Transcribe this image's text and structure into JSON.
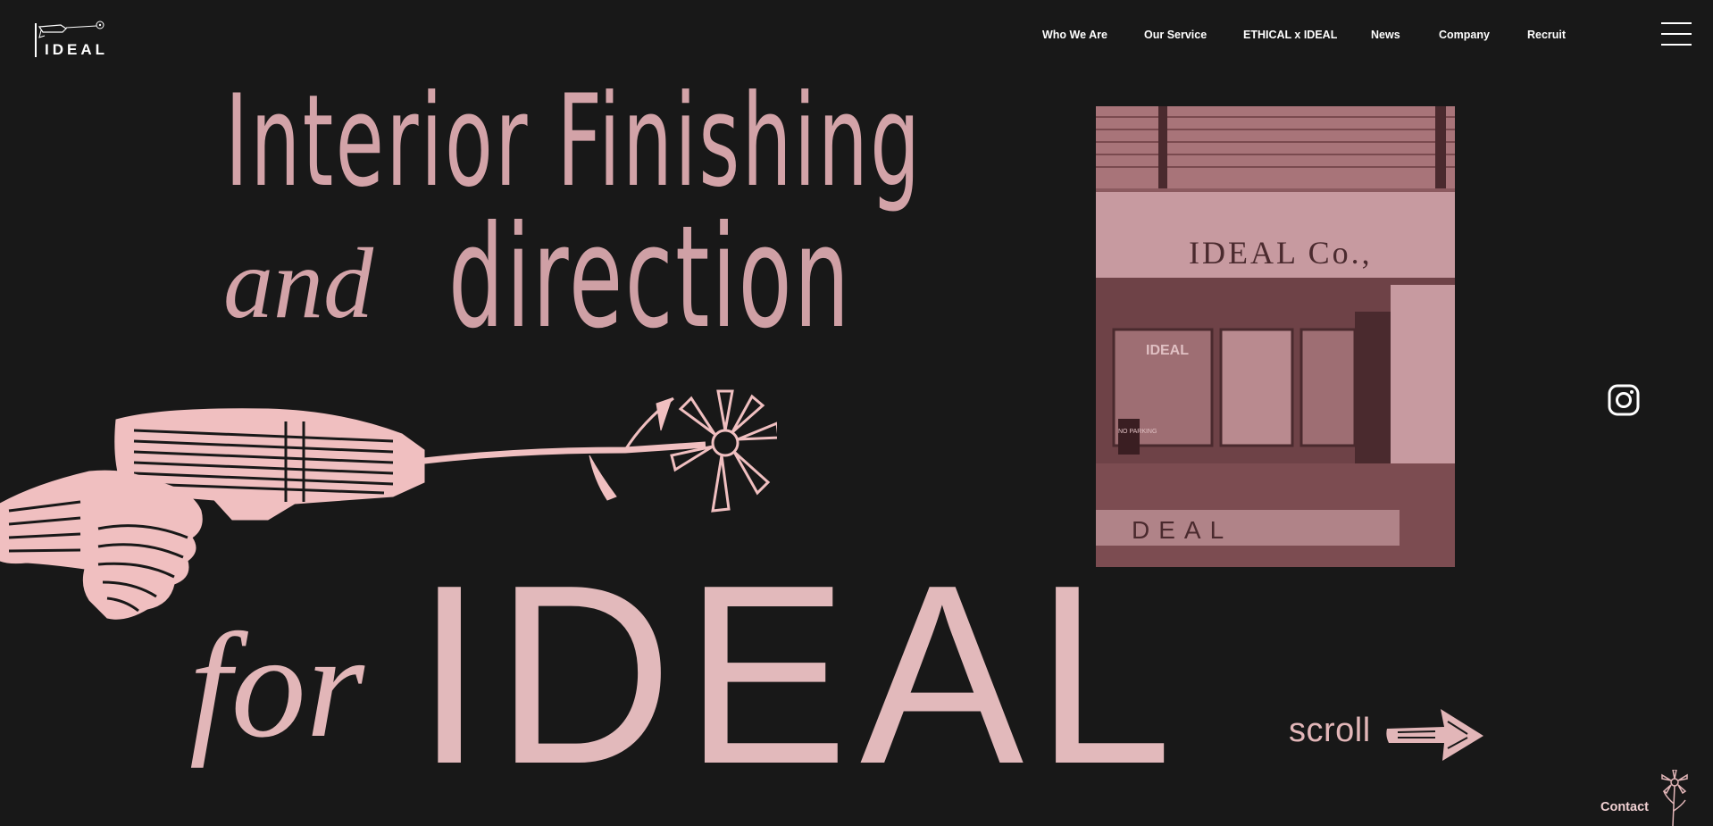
{
  "logo": {
    "text": "IDEAL",
    "icon": "drill-flower-icon"
  },
  "nav": {
    "items": [
      {
        "label": "Who We Are"
      },
      {
        "label": "Our Service"
      },
      {
        "label": "ETHICAL x IDEAL"
      },
      {
        "label": "News"
      },
      {
        "label": "Company"
      },
      {
        "label": "Recruit"
      }
    ],
    "menu_icon": "hamburger-icon"
  },
  "hero": {
    "line1": "Interior Finishing",
    "and": "and",
    "line2": "direction",
    "for": "for",
    "brand": "IDEAL",
    "illustration_icon": "hand-drill-flower-icon"
  },
  "photo": {
    "sign": "IDEAL Co.,",
    "window_sign": "IDEAL",
    "floor_text": "DEAL",
    "parking_sign": "NO PARKING"
  },
  "social": {
    "icon": "instagram-icon"
  },
  "scroll": {
    "label": "scroll",
    "icon": "arrow-right-icon"
  },
  "contact": {
    "label": "Contact",
    "icon": "flower-icon"
  },
  "colors": {
    "background": "#181818",
    "accent": "#e2b6b8",
    "headline": "#d3a3a8",
    "photo_tint": "#8d5d62"
  }
}
